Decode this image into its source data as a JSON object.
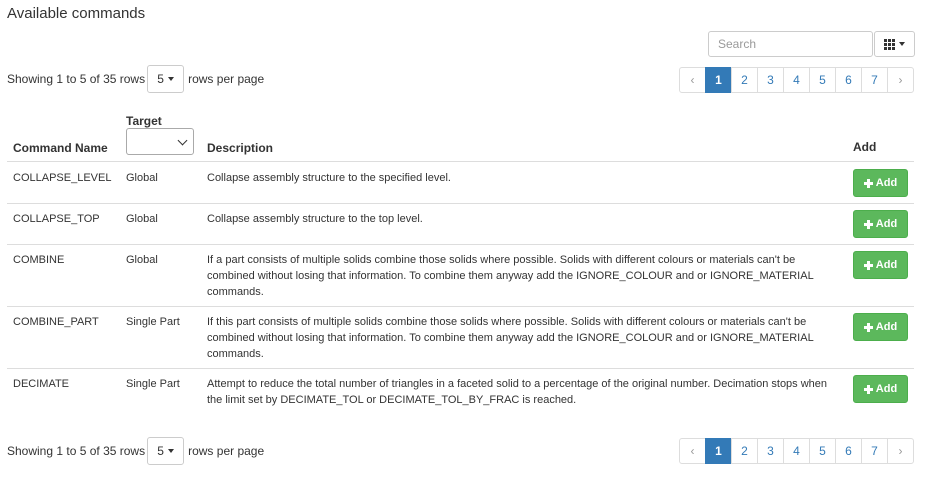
{
  "heading": "Available commands",
  "search": {
    "placeholder": "Search"
  },
  "columns_toggle": {
    "icon": "grid-icon"
  },
  "pagination_info": {
    "showing": "Showing 1 to 5 of 35 rows",
    "page_size": "5",
    "suffix": "rows per page"
  },
  "pager": {
    "prev": "‹",
    "next": "›",
    "pages": [
      "1",
      "2",
      "3",
      "4",
      "5",
      "6",
      "7"
    ],
    "active_page": "1"
  },
  "table": {
    "headers": {
      "name": "Command Name",
      "target": "Target",
      "description": "Description",
      "add": "Add"
    },
    "rows": [
      {
        "name": "COLLAPSE_LEVEL",
        "target": "Global",
        "description": "Collapse assembly structure to the specified level.",
        "action": "Add"
      },
      {
        "name": "COLLAPSE_TOP",
        "target": "Global",
        "description": "Collapse assembly structure to the top level.",
        "action": "Add"
      },
      {
        "name": "COMBINE",
        "target": "Global",
        "description": "If a part consists of multiple solids combine those solids where possible. Solids with different colours or materials can't be combined without losing that information. To combine them anyway add the IGNORE_COLOUR and or IGNORE_MATERIAL commands.",
        "action": "Add"
      },
      {
        "name": "COMBINE_PART",
        "target": "Single Part",
        "description": "If this part consists of multiple solids combine those solids where possible. Solids with different colours or materials can't be combined without losing that information. To combine them anyway add the IGNORE_COLOUR and or IGNORE_MATERIAL commands.",
        "action": "Add"
      },
      {
        "name": "DECIMATE",
        "target": "Single Part",
        "description": "Attempt to reduce the total number of triangles in a faceted solid to a percentage of the original number. Decimation stops when the limit set by DECIMATE_TOL or DECIMATE_TOL_BY_FRAC is reached.",
        "action": "Add"
      }
    ]
  },
  "colors": {
    "primary": "#337ab7",
    "success": "#5cb85c",
    "border": "#dddddd"
  }
}
